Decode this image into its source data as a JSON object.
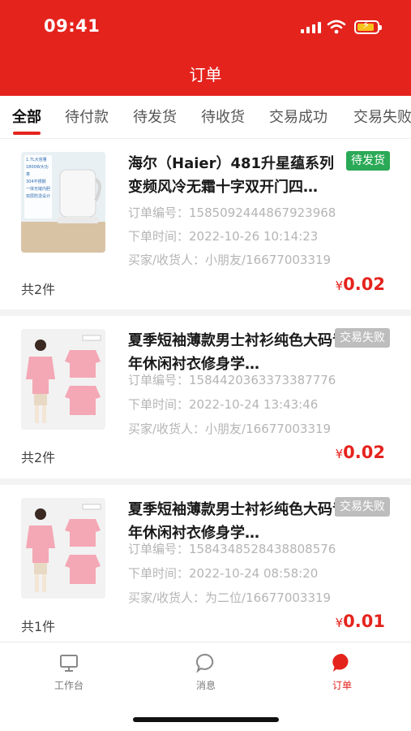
{
  "status_bar": {
    "time": "09:41"
  },
  "header": {
    "title": "订单"
  },
  "tabs": [
    {
      "label": "全部",
      "active": true
    },
    {
      "label": "待付款"
    },
    {
      "label": "待发货"
    },
    {
      "label": "待收货"
    },
    {
      "label": "交易成功"
    },
    {
      "label": "交易失败"
    }
  ],
  "orders": [
    {
      "title": "海尔（Haier）481升星蕴系列变频风冷无霜十字双开门四…",
      "status": "待发货",
      "order_no": "订单编号：1585092444867923968",
      "order_time": "下单时间：2022-10-26 10:14:23",
      "buyer": "买家/收货人：小朋友/16677003319",
      "count": "共2件",
      "currency": "¥",
      "price": "0.02",
      "thumb_texts": [
        "1.7L大容量",
        "1800W大功率",
        "304不锈钢",
        "一体无缝内胆",
        "双层防烫设计"
      ]
    },
    {
      "title": "夏季短袖薄款男士衬衫纯色大码青年休闲衬衣修身学…",
      "status": "交易失败",
      "order_no": "订单编号：1584420363373387776",
      "order_time": "下单时间：2022-10-24 13:43:46",
      "buyer": "买家/收货人：小朋友/16677003319",
      "count": "共2件",
      "currency": "¥",
      "price": "0.02"
    },
    {
      "title": "夏季短袖薄款男士衬衫纯色大码青年休闲衬衣修身学…",
      "status": "交易失败",
      "order_no": "订单编号：1584348528438808576",
      "order_time": "下单时间：2022-10-24 08:58:20",
      "buyer": "买家/收货人：为二位/16677003319",
      "count": "共1件",
      "currency": "¥",
      "price": "0.01"
    }
  ],
  "bottom_nav": [
    {
      "label": "工作台",
      "icon": "monitor-icon"
    },
    {
      "label": "消息",
      "icon": "chat-bubble-icon"
    },
    {
      "label": "订单",
      "icon": "order-bubble-icon",
      "active": true
    }
  ],
  "colors": {
    "brand": "#e5231d",
    "status_pending": "#2aa956",
    "status_failed": "#bdbdbd"
  }
}
